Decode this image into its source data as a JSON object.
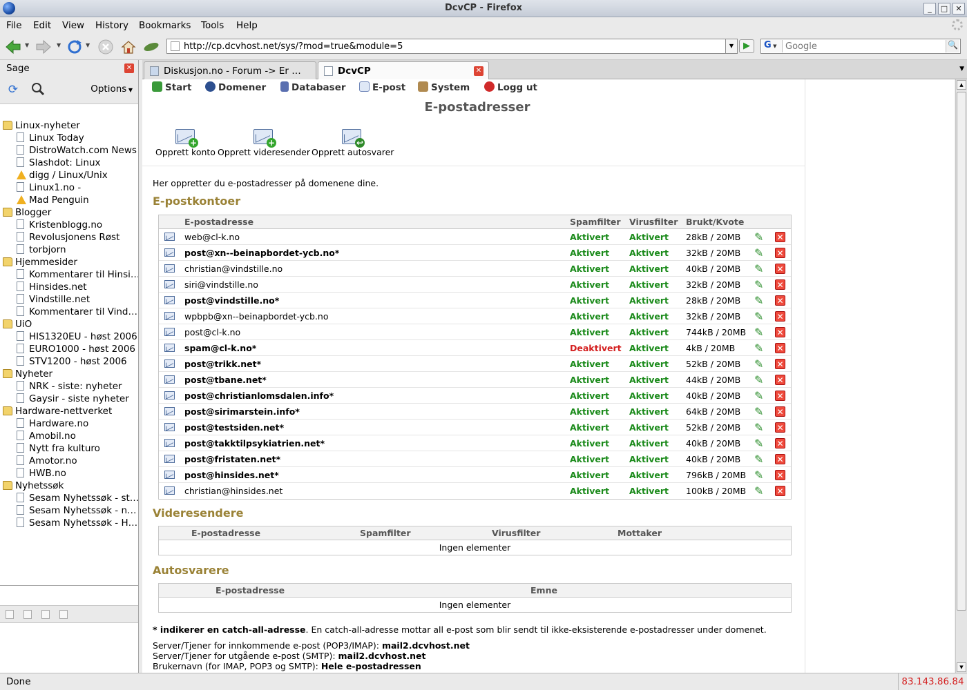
{
  "window": {
    "title": "DcvCP - Firefox",
    "controls": [
      "_",
      "□",
      "✕"
    ]
  },
  "menu": [
    "File",
    "Edit",
    "View",
    "History",
    "Bookmarks",
    "Tools",
    "Help"
  ],
  "nav": {
    "url": "http://cp.dcvhost.net/sys/?mod=true&module=5",
    "search_engine": "G",
    "search_placeholder": "Google"
  },
  "sidebar": {
    "title": "Sage",
    "options_label": "Options",
    "tree": [
      {
        "label": "Linux-nyheter",
        "type": "folder"
      },
      {
        "label": "Linux Today",
        "type": "page"
      },
      {
        "label": "DistroWatch.com News",
        "type": "page"
      },
      {
        "label": "Slashdot: Linux",
        "type": "page"
      },
      {
        "label": "digg / Linux/Unix",
        "type": "warn"
      },
      {
        "label": "Linux1.no -",
        "type": "page"
      },
      {
        "label": "Mad Penguin",
        "type": "warn"
      },
      {
        "label": "Blogger",
        "type": "folder"
      },
      {
        "label": "Kristenblogg.no",
        "type": "page"
      },
      {
        "label": "Revolusjonens Røst",
        "type": "page"
      },
      {
        "label": "torbjorn",
        "type": "page"
      },
      {
        "label": "Hjemmesider",
        "type": "folder"
      },
      {
        "label": "Kommentarer til Hinsi…",
        "type": "page"
      },
      {
        "label": "Hinsides.net",
        "type": "page"
      },
      {
        "label": "Vindstille.net",
        "type": "page"
      },
      {
        "label": "Kommentarer til Vind…",
        "type": "page"
      },
      {
        "label": "UiO",
        "type": "folder"
      },
      {
        "label": "HIS1320EU - høst 2006",
        "type": "page"
      },
      {
        "label": "EURO1000 - høst 2006",
        "type": "page"
      },
      {
        "label": "STV1200 - høst 2006",
        "type": "page"
      },
      {
        "label": "Nyheter",
        "type": "folder"
      },
      {
        "label": "NRK - siste: nyheter",
        "type": "page"
      },
      {
        "label": "Gaysir - siste nyheter",
        "type": "page"
      },
      {
        "label": "Hardware-nettverket",
        "type": "folder"
      },
      {
        "label": "Hardware.no",
        "type": "page"
      },
      {
        "label": "Amobil.no",
        "type": "page"
      },
      {
        "label": "Nytt fra kulturo",
        "type": "page"
      },
      {
        "label": "Amotor.no",
        "type": "page"
      },
      {
        "label": "HWB.no",
        "type": "page"
      },
      {
        "label": "Nyhetssøk",
        "type": "folder"
      },
      {
        "label": "Sesam Nyhetssøk - st…",
        "type": "page"
      },
      {
        "label": "Sesam Nyhetssøk - n…",
        "type": "page"
      },
      {
        "label": "Sesam Nyhetssøk - H…",
        "type": "page"
      }
    ]
  },
  "tabs": [
    {
      "label": "Diskusjon.no - Forum -> Er …",
      "active": false
    },
    {
      "label": "DcvCP",
      "active": true
    }
  ],
  "topnav": [
    {
      "label": "Start",
      "icon": "home-icon",
      "color": "#3a9a3a"
    },
    {
      "label": "Domener",
      "icon": "globe-icon",
      "color": "#2d4f8f"
    },
    {
      "label": "Databaser",
      "icon": "database-icon",
      "color": "#5a6fb0"
    },
    {
      "label": "E-post",
      "icon": "mail-icon",
      "color": "#6f86b8"
    },
    {
      "label": "System",
      "icon": "tools-icon",
      "color": "#b08a50"
    },
    {
      "label": "Logg ut",
      "icon": "logout-icon",
      "color": "#d02a2a"
    }
  ],
  "page": {
    "title": "E-postadresser",
    "actions": [
      "Opprett konto",
      "Opprett videresender",
      "Opprett autosvarer"
    ],
    "intro": "Her oppretter du e-postadresser på domenene dine.",
    "accounts_title": "E-postkontoer",
    "accounts_headers": [
      "E-postadresse",
      "Spamfilter",
      "Virusfilter",
      "Brukt/Kvote"
    ],
    "accounts": [
      {
        "address": "web@cl-k.no",
        "bold": false,
        "spam": "Aktivert",
        "virus": "Aktivert",
        "usage": "28kB / 20MB"
      },
      {
        "address": "post@xn--beinapbordet-ycb.no*",
        "bold": true,
        "spam": "Aktivert",
        "virus": "Aktivert",
        "usage": "32kB / 20MB"
      },
      {
        "address": "christian@vindstille.no",
        "bold": false,
        "spam": "Aktivert",
        "virus": "Aktivert",
        "usage": "40kB / 20MB"
      },
      {
        "address": "siri@vindstille.no",
        "bold": false,
        "spam": "Aktivert",
        "virus": "Aktivert",
        "usage": "32kB / 20MB"
      },
      {
        "address": "post@vindstille.no*",
        "bold": true,
        "spam": "Aktivert",
        "virus": "Aktivert",
        "usage": "28kB / 20MB"
      },
      {
        "address": "wpbpb@xn--beinapbordet-ycb.no",
        "bold": false,
        "spam": "Aktivert",
        "virus": "Aktivert",
        "usage": "32kB / 20MB"
      },
      {
        "address": "post@cl-k.no",
        "bold": false,
        "spam": "Aktivert",
        "virus": "Aktivert",
        "usage": "744kB / 20MB"
      },
      {
        "address": "spam@cl-k.no*",
        "bold": true,
        "spam": "Deaktivert",
        "virus": "Aktivert",
        "usage": "4kB / 20MB"
      },
      {
        "address": "post@trikk.net*",
        "bold": true,
        "spam": "Aktivert",
        "virus": "Aktivert",
        "usage": "52kB / 20MB"
      },
      {
        "address": "post@tbane.net*",
        "bold": true,
        "spam": "Aktivert",
        "virus": "Aktivert",
        "usage": "44kB / 20MB"
      },
      {
        "address": "post@christianlomsdalen.info*",
        "bold": true,
        "spam": "Aktivert",
        "virus": "Aktivert",
        "usage": "40kB / 20MB"
      },
      {
        "address": "post@sirimarstein.info*",
        "bold": true,
        "spam": "Aktivert",
        "virus": "Aktivert",
        "usage": "64kB / 20MB"
      },
      {
        "address": "post@testsiden.net*",
        "bold": true,
        "spam": "Aktivert",
        "virus": "Aktivert",
        "usage": "52kB / 20MB"
      },
      {
        "address": "post@takktilpsykiatrien.net*",
        "bold": true,
        "spam": "Aktivert",
        "virus": "Aktivert",
        "usage": "40kB / 20MB"
      },
      {
        "address": "post@fristaten.net*",
        "bold": true,
        "spam": "Aktivert",
        "virus": "Aktivert",
        "usage": "40kB / 20MB"
      },
      {
        "address": "post@hinsides.net*",
        "bold": true,
        "spam": "Aktivert",
        "virus": "Aktivert",
        "usage": "796kB / 20MB"
      },
      {
        "address": "christian@hinsides.net",
        "bold": false,
        "spam": "Aktivert",
        "virus": "Aktivert",
        "usage": "100kB / 20MB"
      }
    ],
    "forwarders_title": "Videresendere",
    "forwarders_headers": [
      "E-postadresse",
      "Spamfilter",
      "Virusfilter",
      "Mottaker"
    ],
    "forwarders_empty": "Ingen elementer",
    "autoresponders_title": "Autosvarere",
    "autoresponders_headers": [
      "E-postadresse",
      "Emne"
    ],
    "autoresponders_empty": "Ingen elementer",
    "footnote_bold": "* indikerer en catch-all-adresse",
    "footnote_rest": ". En catch-all-adresse mottar all e-post som blir sendt til ikke-eksisterende e-postadresser under domenet.",
    "servers": [
      {
        "label": "Server/Tjener for innkommende e-post (POP3/IMAP): ",
        "value": "mail2.dcvhost.net"
      },
      {
        "label": "Server/Tjener for utgående e-post (SMTP): ",
        "value": "mail2.dcvhost.net"
      },
      {
        "label": "Brukernavn (for IMAP, POP3 og SMTP): ",
        "value": "Hele e-postadressen"
      }
    ]
  },
  "status": {
    "text": "Done",
    "ip": "83.143.86.84"
  }
}
